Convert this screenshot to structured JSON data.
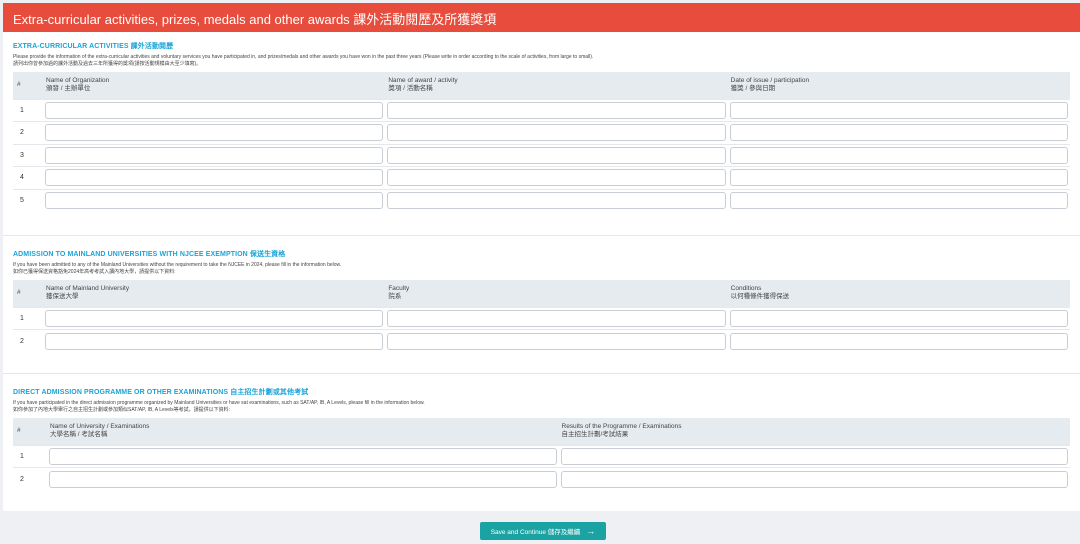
{
  "header": {
    "title": "Extra-curricular activities, prizes, medals and other awards   課外活動閱歷及所獲獎項"
  },
  "sections": [
    {
      "title": "EXTRA-CURRICULAR ACTIVITIES 課外活動閱歷",
      "desc_en": "Please provide the information of the extra-curricular activities and voluntary services you have participated in, and prizes/medals and other awards you have won in the past three years (Please write in order according to the scale of activities, from large to small).",
      "desc_zh": "請列出你曾參加過的課外活動及過去三年所獲得的獎項(請按活動規模由大至少填寫)。",
      "col0": "#",
      "columns": [
        {
          "en": "Name of Organization",
          "zh": "頒發 / 主辦單位"
        },
        {
          "en": "Name of award / activity",
          "zh": "獎項 / 活動名稱"
        },
        {
          "en": "Date of issue / participation",
          "zh": "獲獎 / 參與日期"
        }
      ],
      "rows": [
        "1",
        "2",
        "3",
        "4",
        "5"
      ]
    },
    {
      "title": "ADMISSION TO MAINLAND UNIVERSITIES WITH NJCEE EXEMPTION 保送生資格",
      "desc_en": "If you have been admitted to any of the Mainland Universities without the requirement to take the NJCEE in 2024, please fill in the information below.",
      "desc_zh": "如你已獲得保送資格豁免2024年高考考試入讀內地大學，請提供以下資料:",
      "col0": "#",
      "columns": [
        {
          "en": "Name of Mainland University",
          "zh": "獲保送大學"
        },
        {
          "en": "Faculty",
          "zh": "院系"
        },
        {
          "en": "Conditions",
          "zh": "以何種條件獲得保送"
        }
      ],
      "rows": [
        "1",
        "2"
      ]
    },
    {
      "title": "DIRECT ADMISSION PROGRAMME OR OTHER EXAMINATIONS 自主招生計劃或其他考試",
      "desc_en": "If you have participated in the direct admission programme organized by Mainland Universities or have sat examinations, such as SAT/AP, IB, A Levels, please fill in the information below.",
      "desc_zh": "如你參加了內地大學舉行之自主招生計劃或參加類似SAT/AP, IB, A Levels等考試，請提供以下資料:",
      "col0": "#",
      "columns": [
        {
          "en": "Name of University / Examinations",
          "zh": "大學名稱 / 考試名稱"
        },
        {
          "en": "Results of the Programme / Examinations",
          "zh": "自主招生計劃/考試結果"
        }
      ],
      "rows": [
        "1",
        "2"
      ]
    }
  ],
  "footer": {
    "button_label": "Save and Continue 儲存及繼續",
    "button_icon": "arrow-right-icon"
  }
}
